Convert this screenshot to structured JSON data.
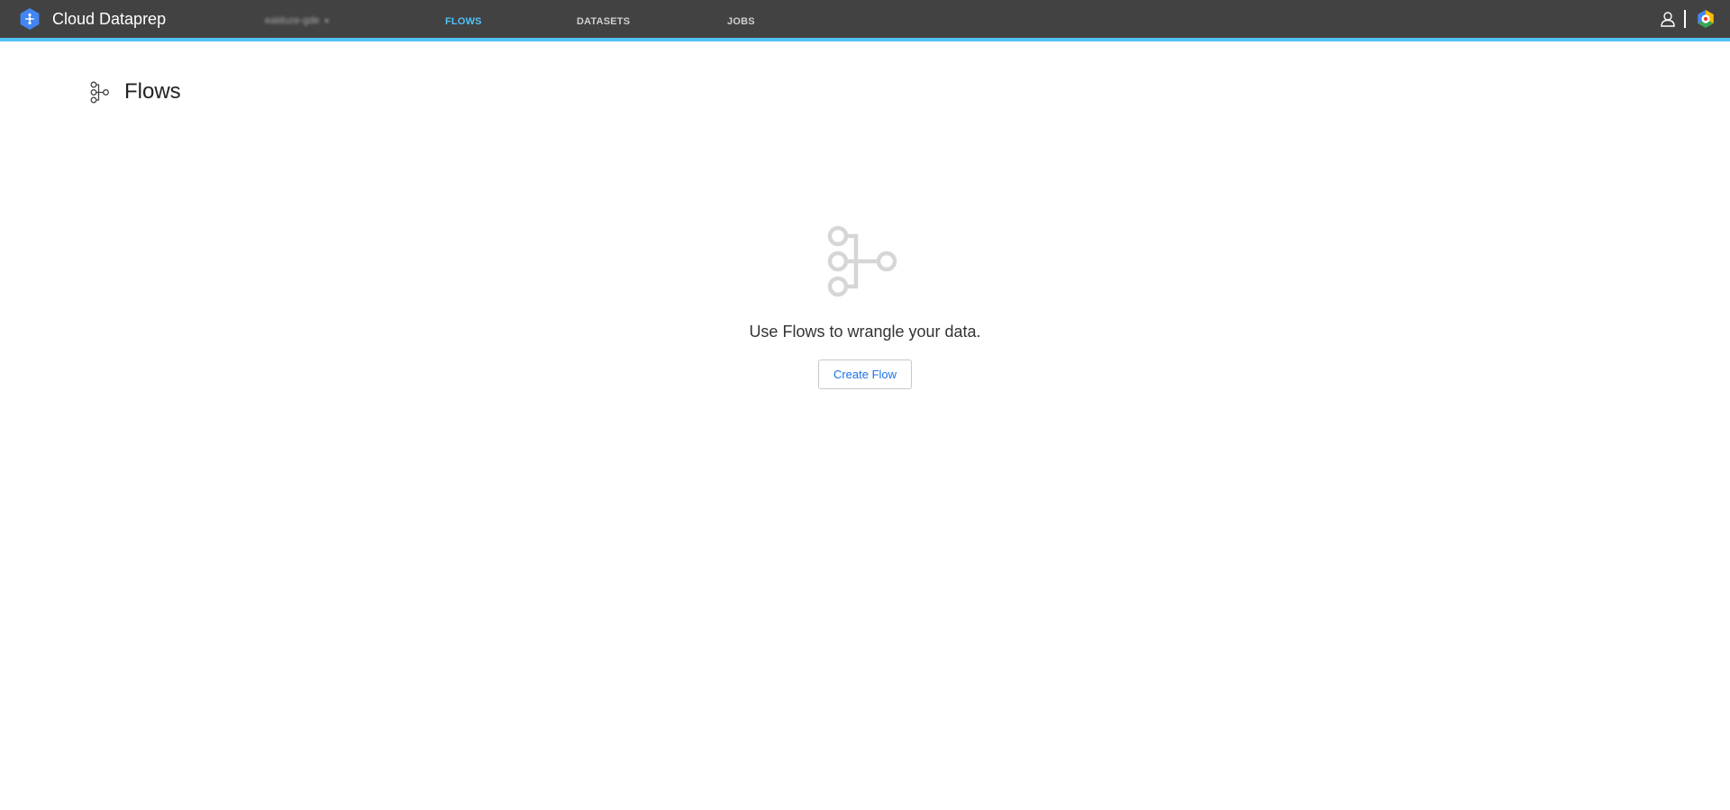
{
  "app": {
    "title": "Cloud Dataprep",
    "logo_icon": "dataprep-logo-icon",
    "project_selector": {
      "value": "ealduze-gde"
    },
    "accent_color": "#4fc3f7",
    "topbar_color": "#424242"
  },
  "nav": {
    "tabs": [
      {
        "label": "FLOWS",
        "active": true
      },
      {
        "label": "DATASETS",
        "active": false
      },
      {
        "label": "JOBS",
        "active": false
      }
    ]
  },
  "header_actions": {
    "user_icon": "user-icon",
    "cloud_icon": "google-cloud-icon"
  },
  "page": {
    "title": "Flows",
    "icon": "flows-icon"
  },
  "empty_state": {
    "icon": "flows-icon",
    "message": "Use Flows to wrangle your data.",
    "button_label": "Create Flow",
    "button_color": "#1a73e8"
  }
}
